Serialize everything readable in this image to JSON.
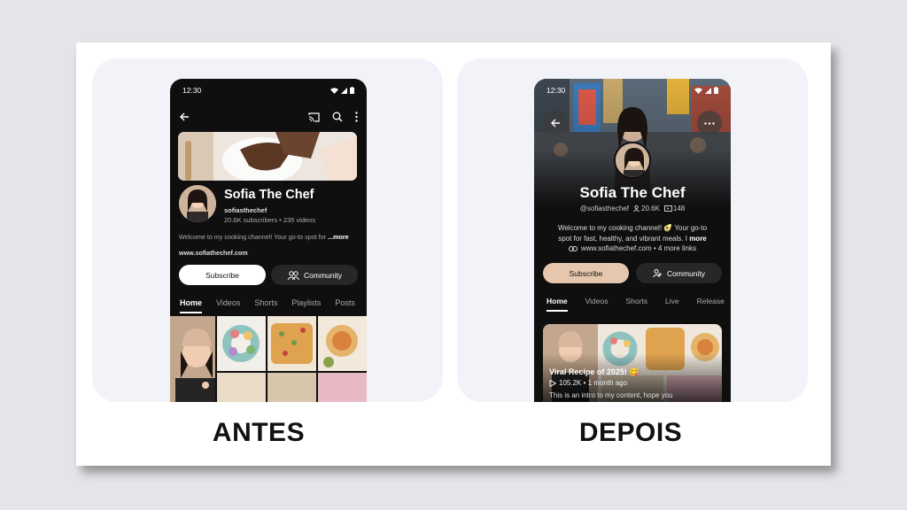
{
  "before": {
    "caption": "ANTES",
    "status_time": "12:30",
    "channel_name": "Sofia The Chef",
    "handle": "sofiasthechef",
    "stats": "20.6K subscribers • 235 videos",
    "description": "Welcome to my cooking channel! Your go-to spot for",
    "more": "...more",
    "link": "www.sofiathechef.com",
    "subscribe": "Subscribe",
    "community": "Community",
    "tabs": [
      "Home",
      "Videos",
      "Shorts",
      "Playlists",
      "Posts"
    ]
  },
  "after": {
    "caption": "DEPOIS",
    "status_time": "12:30",
    "channel_name": "Sofia The Chef",
    "handle": "@sofiasthechef",
    "subscribers": "20.6K",
    "videos": "148",
    "description_line1": "Welcome to my cooking channel! 🥑 Your go-to",
    "description_line2": "spot for fast, healthy, and vibrant meals. I",
    "more": "more",
    "link": "www.sofiathechef.com • 4 more links",
    "subscribe": "Subscribe",
    "community": "Community",
    "tabs": [
      "Home",
      "Videos",
      "Shorts",
      "Live",
      "Release"
    ],
    "video_title": "Viral Recipe of 2025! 😋",
    "video_meta": "105.2K • 1 month ago",
    "video_desc": "This is an intro to my content, hope you"
  },
  "colors": {
    "phone_bg": "#0f0f0f",
    "subscribe_before": "#ffffff",
    "subscribe_after": "#e6c7ae",
    "community_bg": "#272727",
    "panel_bg": "#f2f3f9"
  }
}
